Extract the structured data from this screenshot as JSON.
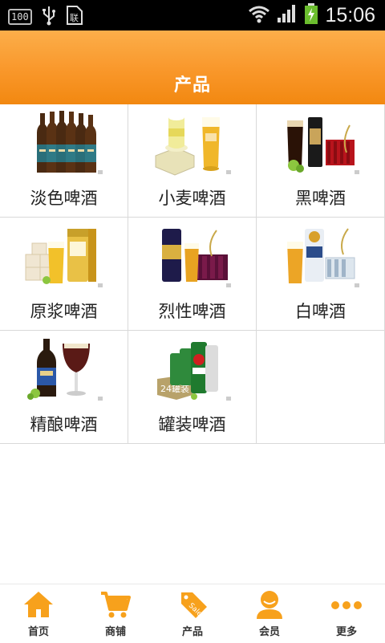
{
  "status_bar": {
    "badge": "100",
    "time": "15:06"
  },
  "header": {
    "title": "产品"
  },
  "products": [
    {
      "label": "淡色啤酒",
      "icon": "beer-bottles-image"
    },
    {
      "label": "小麦啤酒",
      "icon": "wheat-beer-image"
    },
    {
      "label": "黑啤酒",
      "icon": "dark-beer-image"
    },
    {
      "label": "原浆啤酒",
      "icon": "raw-beer-image"
    },
    {
      "label": "烈性啤酒",
      "icon": "strong-beer-image"
    },
    {
      "label": "白啤酒",
      "icon": "white-beer-image"
    },
    {
      "label": "精酿啤酒",
      "icon": "craft-beer-image"
    },
    {
      "label": "罐装啤酒",
      "icon": "canned-beer-image"
    }
  ],
  "can_badge": "24罐装",
  "bottom_nav": [
    {
      "label": "首页",
      "icon": "home-icon"
    },
    {
      "label": "商铺",
      "icon": "cart-icon"
    },
    {
      "label": "产品",
      "icon": "sale-tag-icon",
      "tag_text": "Sale"
    },
    {
      "label": "会员",
      "icon": "member-icon"
    },
    {
      "label": "更多",
      "icon": "more-icon"
    }
  ],
  "colors": {
    "accent": "#f9972a",
    "nav_icon": "#f7a11c",
    "grid_line": "#d9d9d9"
  }
}
